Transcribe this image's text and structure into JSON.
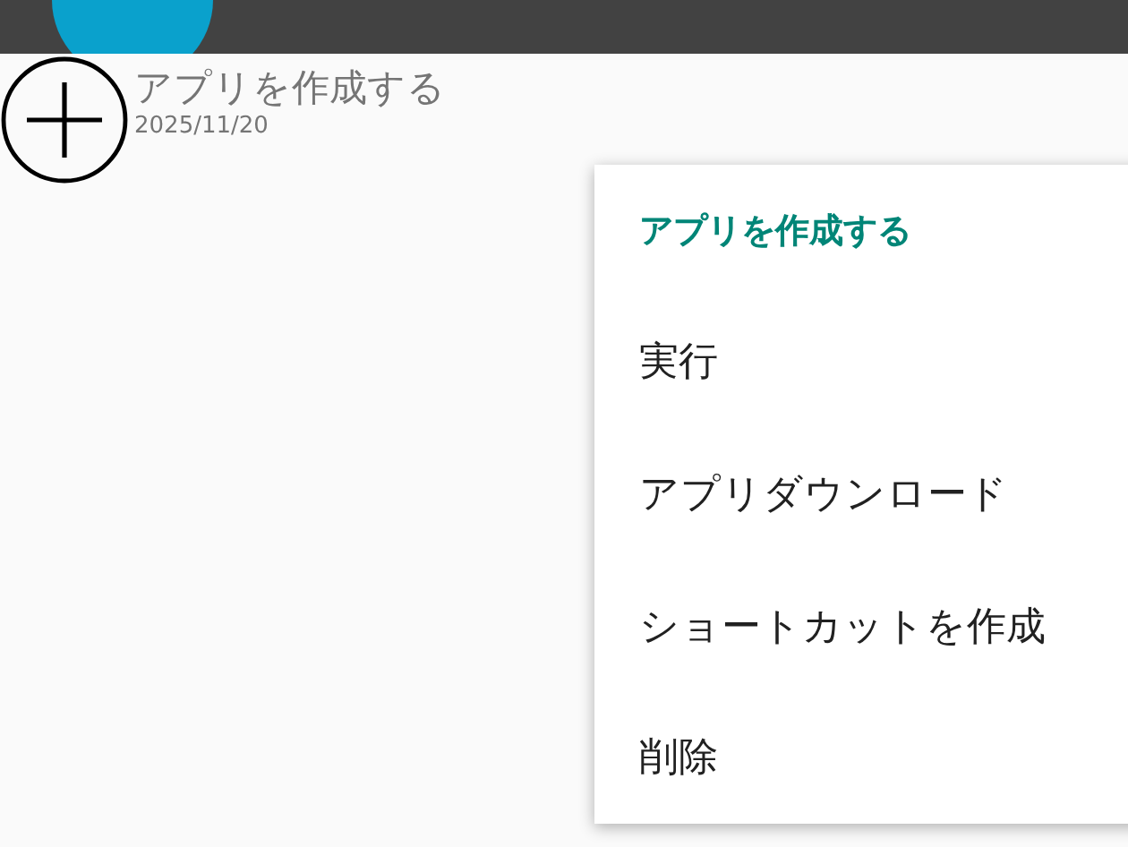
{
  "app_item": {
    "title": "アプリを作成する",
    "date": "2025/11/20"
  },
  "context_menu": {
    "title": "アプリを作成する",
    "items": [
      {
        "label": "実行"
      },
      {
        "label": "アプリダウンロード"
      },
      {
        "label": "ショートカットを作成"
      },
      {
        "label": "削除"
      }
    ]
  }
}
